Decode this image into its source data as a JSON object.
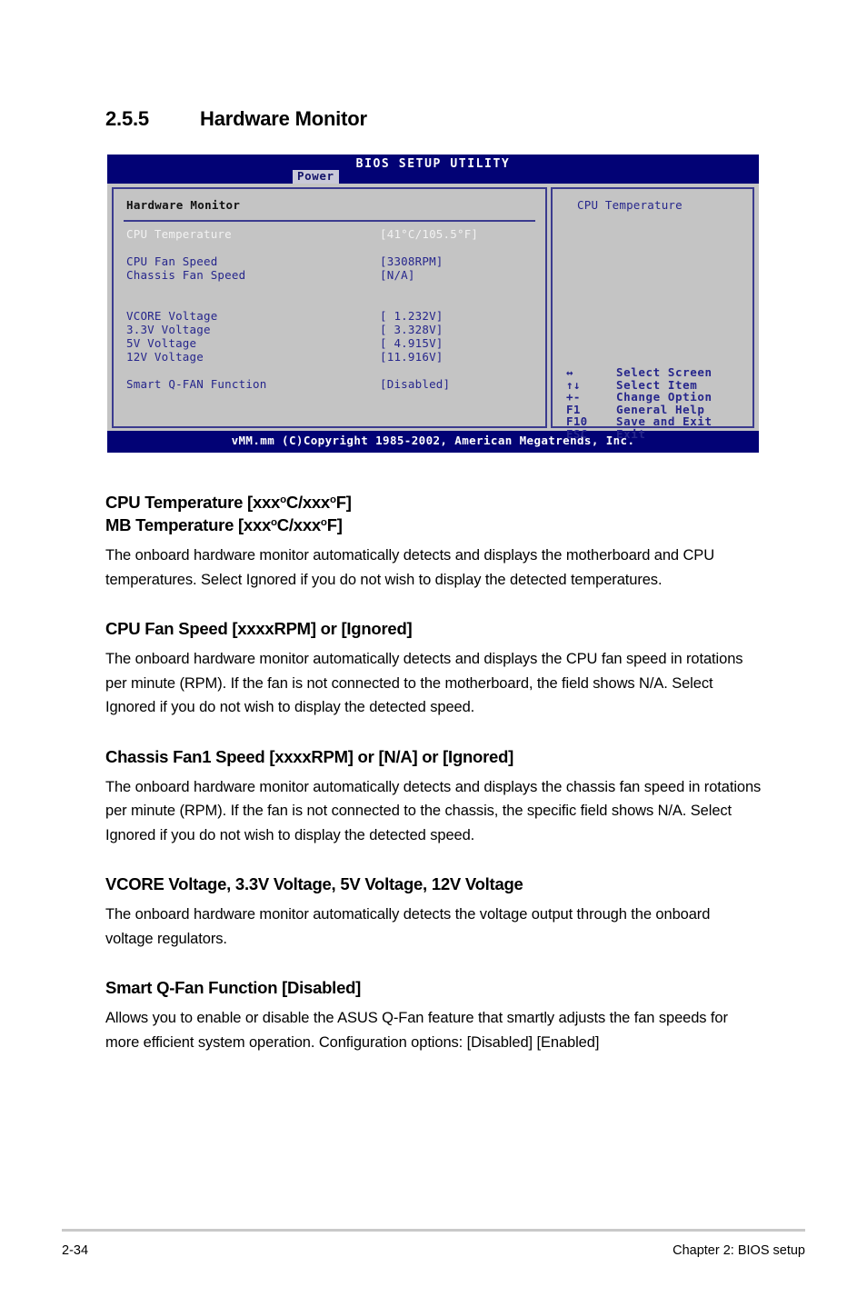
{
  "page": {
    "section_number": "2.5.5",
    "section_title": "Hardware Monitor",
    "footer_page": "2-34",
    "footer_chapter": "Chapter 2: BIOS setup"
  },
  "bios": {
    "title": "BIOS SETUP UTILITY",
    "active_tab": "Power",
    "panel_title": "Hardware Monitor",
    "footer": "vMM.mm (C)Copyright 1985-2002, American Megatrends, Inc.",
    "colors": {
      "titlebar": "#020275",
      "screen": "#c4c4c4",
      "border": "#3b3b8f",
      "text": "#26268c",
      "selected_text": "#f2f2f2",
      "tab_bg": "#c8c8d8"
    },
    "rows": [
      {
        "label": "CPU Temperature",
        "value": "[41°C/105.5°F]",
        "selected": true
      },
      {
        "label": "CPU Fan Speed",
        "value": "[3308RPM]",
        "selected": false
      },
      {
        "label": "Chassis Fan Speed",
        "value": "[N/A]",
        "selected": false
      },
      {
        "label": "VCORE Voltage",
        "value": "[ 1.232V]",
        "selected": false
      },
      {
        "label": "3.3V Voltage",
        "value": "[ 3.328V]",
        "selected": false
      },
      {
        "label": "5V Voltage",
        "value": "[ 4.915V]",
        "selected": false
      },
      {
        "label": "12V Voltage",
        "value": "[11.916V]",
        "selected": false
      },
      {
        "label": "Smart Q-FAN Function",
        "value": "[Disabled]",
        "selected": false
      }
    ],
    "help": {
      "text": "CPU Temperature",
      "legend": [
        {
          "key": "↔",
          "desc": "Select Screen"
        },
        {
          "key": "↑↓",
          "desc": "Select Item"
        },
        {
          "key": "+-",
          "desc": "Change Option"
        },
        {
          "key": "F1",
          "desc": "General Help"
        },
        {
          "key": "F10",
          "desc": "Save and Exit"
        },
        {
          "key": "ESC",
          "desc": "Exit"
        }
      ]
    }
  },
  "sections": [
    {
      "heading_1": "CPU Temperature [xxx°C/xxx°F]",
      "heading_2": "MB Temperature [xxx°C/xxx°F]",
      "body": "The onboard hardware monitor automatically detects and displays the motherboard and CPU temperatures. Select Ignored if you do not wish to display the detected temperatures."
    },
    {
      "heading_1": "CPU Fan Speed [xxxxRPM] or [Ignored]",
      "body": "The onboard hardware monitor automatically detects and displays the CPU fan speed in rotations per minute (RPM). If the fan is not connected to the motherboard, the field shows N/A. Select Ignored if you do not wish to display the detected speed."
    },
    {
      "heading_1": "Chassis Fan1 Speed [xxxxRPM] or [N/A] or [Ignored]",
      "body": "The onboard hardware monitor automatically detects and displays the chassis fan speed in rotations per minute (RPM). If the fan is not connected to the chassis, the specific field shows N/A. Select Ignored if you do not wish to display the detected speed."
    },
    {
      "heading_1": "VCORE Voltage, 3.3V Voltage, 5V Voltage, 12V Voltage",
      "body": "The onboard hardware monitor automatically detects the voltage output through the onboard voltage regulators."
    },
    {
      "heading_1": "Smart Q-Fan Function [Disabled]",
      "body": "Allows you to enable or disable the ASUS Q-Fan feature that smartly adjusts the fan speeds for more efficient system operation. Configuration options: [Disabled] [Enabled]"
    }
  ]
}
